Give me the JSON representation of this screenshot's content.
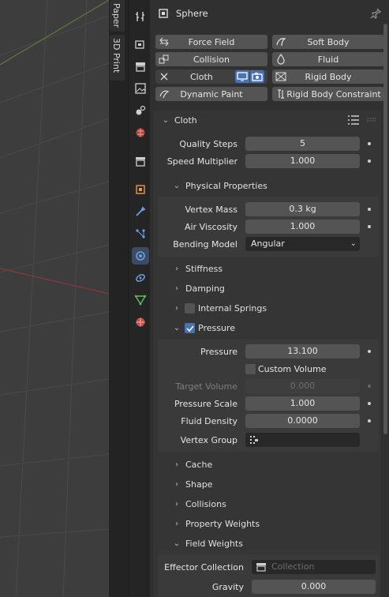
{
  "vertical_tabs": [
    {
      "label": "Paper"
    },
    {
      "label": "3D Print"
    }
  ],
  "header": {
    "object_name": "Sphere"
  },
  "physics_buttons": {
    "force_field": "Force Field",
    "soft_body": "Soft Body",
    "collision": "Collision",
    "fluid": "Fluid",
    "cloth": "Cloth",
    "rigid_body": "Rigid Body",
    "dynamic_paint": "Dynamic Paint",
    "rigid_body_constraint": "Rigid Body Constraint"
  },
  "cloth_panel": {
    "title": "Cloth",
    "quality_steps": {
      "label": "Quality Steps",
      "value": "5"
    },
    "speed_multiplier": {
      "label": "Speed Multiplier",
      "value": "1.000"
    },
    "physical_properties": {
      "title": "Physical Properties",
      "vertex_mass": {
        "label": "Vertex Mass",
        "value": "0.3 kg"
      },
      "air_viscosity": {
        "label": "Air Viscosity",
        "value": "1.000"
      },
      "bending_model": {
        "label": "Bending Model",
        "value": "Angular"
      }
    },
    "stiffness": "Stiffness",
    "damping": "Damping",
    "internal_springs": "Internal Springs",
    "pressure": {
      "title": "Pressure",
      "pressure": {
        "label": "Pressure",
        "value": "13.100"
      },
      "custom_volume": "Custom Volume",
      "target_volume": {
        "label": "Target Volume",
        "value": "0.000"
      },
      "pressure_scale": {
        "label": "Pressure Scale",
        "value": "1.000"
      },
      "fluid_density": {
        "label": "Fluid Density",
        "value": "0.0000"
      },
      "vertex_group": {
        "label": "Vertex Group"
      }
    },
    "cache": "Cache",
    "shape": "Shape",
    "collisions": "Collisions",
    "property_weights": "Property Weights",
    "field_weights": {
      "title": "Field Weights",
      "effector_collection": {
        "label": "Effector Collection",
        "placeholder": "Collection"
      },
      "gravity": {
        "label": "Gravity",
        "value": "0.000"
      }
    }
  },
  "colors": {
    "accent": "#4772b3",
    "active_tab": "#3d4a63",
    "button": "#545454"
  }
}
